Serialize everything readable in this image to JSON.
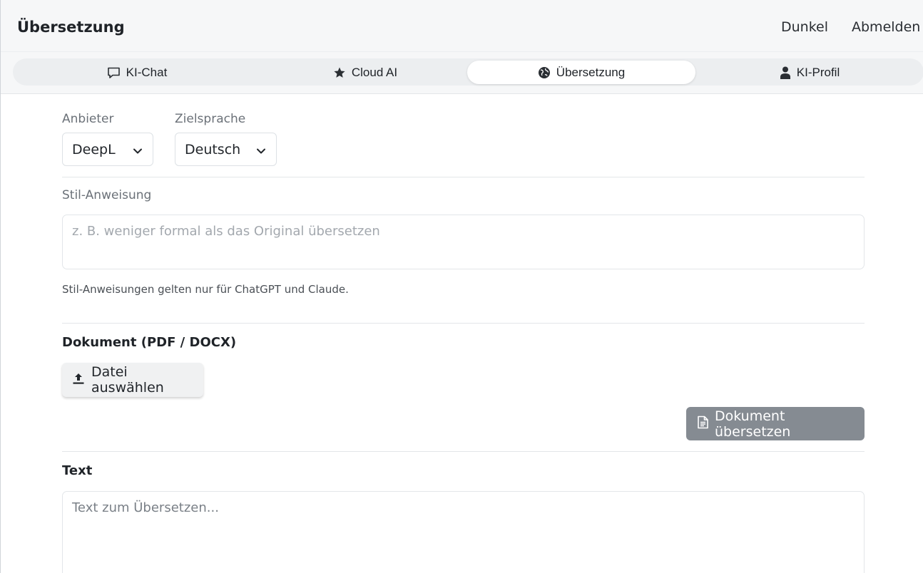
{
  "header": {
    "title": "Übersetzung",
    "theme_toggle": "Dunkel",
    "logout": "Abmelden"
  },
  "tabs": [
    {
      "label": "KI-Chat",
      "icon": "chat-bubble-icon",
      "active": false
    },
    {
      "label": "Cloud AI",
      "icon": "star-icon",
      "active": false
    },
    {
      "label": "Übersetzung",
      "icon": "globe-icon",
      "active": true
    },
    {
      "label": "KI-Profil",
      "icon": "person-icon",
      "active": false
    }
  ],
  "provider": {
    "label": "Anbieter",
    "value": "DeepL"
  },
  "target_language": {
    "label": "Zielsprache",
    "value": "Deutsch"
  },
  "style": {
    "label": "Stil-Anweisung",
    "placeholder": "z. B. weniger formal als das Original übersetzen",
    "hint": "Stil-Anweisungen gelten nur für ChatGPT und Claude."
  },
  "document": {
    "title": "Dokument (PDF / DOCX)",
    "choose_file": "Datei auswählen",
    "translate_button": "Dokument übersetzen"
  },
  "text": {
    "title": "Text",
    "placeholder": "Text zum Übersetzen..."
  },
  "colors": {
    "header_bg": "#f6f7f8",
    "tabbar_bg": "#eceef0",
    "disabled_button": "#858b92"
  }
}
